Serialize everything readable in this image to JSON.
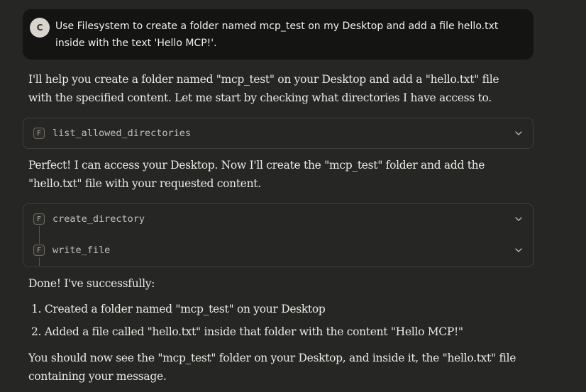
{
  "user_message": {
    "avatar_initial": "C",
    "text": "Use Filesystem to create a folder named mcp_test on my Desktop and add a file hello.txt inside with the text 'Hello MCP!'."
  },
  "assistant": {
    "intro": "I'll help you create a folder named \"mcp_test\" on your Desktop and add a \"hello.txt\" file with the specified content. Let me start by checking what directories I have access to.",
    "tool_group_1": [
      {
        "badge": "F",
        "name": "list_allowed_directories"
      }
    ],
    "middle": "Perfect! I can access your Desktop. Now I'll create the \"mcp_test\" folder and add the \"hello.txt\" file with your requested content.",
    "tool_group_2": [
      {
        "badge": "F",
        "name": "create_directory"
      },
      {
        "badge": "F",
        "name": "write_file"
      }
    ],
    "done": "Done! I've successfully:",
    "steps": [
      "1. Created a folder named \"mcp_test\" on your Desktop",
      "2. Added a file called \"hello.txt\" inside that folder with the content \"Hello MCP!\""
    ],
    "closing": "You should now see the \"mcp_test\" folder on your Desktop, and inside it, the \"hello.txt\" file containing your message."
  }
}
